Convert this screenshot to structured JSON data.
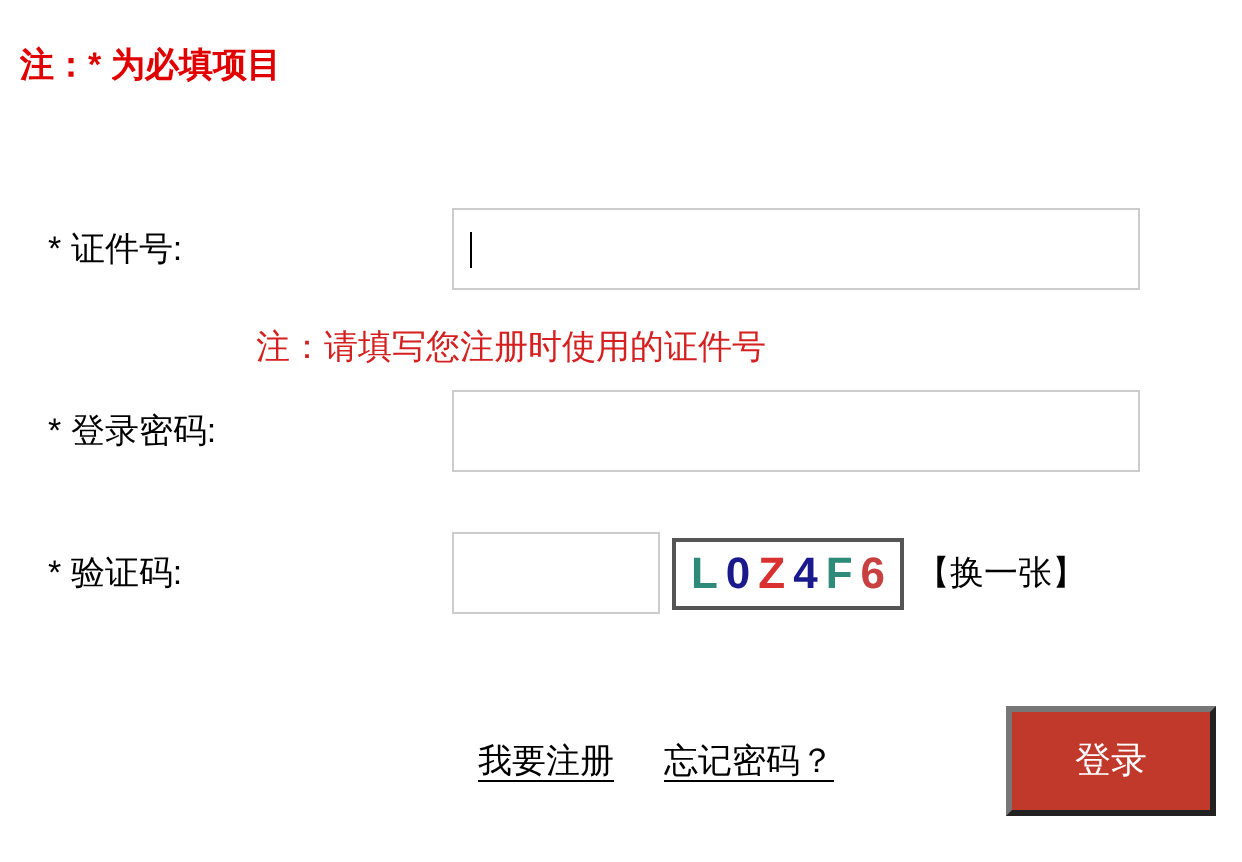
{
  "required_note": "注：* 为必填项目",
  "fields": [
    {
      "label": "* 证件号:",
      "kind": "text",
      "focused": true,
      "hint": "注：请填写您注册时使用的证件号"
    },
    {
      "label": "* 登录密码:",
      "kind": "password",
      "focused": false
    },
    {
      "label": "* 验证码:",
      "kind": "captcha",
      "focused": false,
      "captcha": [
        {
          "char": "L",
          "color": "#2e8b7a"
        },
        {
          "char": "0",
          "color": "#1a1a8c"
        },
        {
          "char": "Z",
          "color": "#d93030"
        },
        {
          "char": "4",
          "color": "#1a1a8c"
        },
        {
          "char": "F",
          "color": "#2e8b7a"
        },
        {
          "char": "6",
          "color": "#c84040"
        }
      ],
      "refresh": "【换一张】"
    }
  ],
  "links": [
    "我要注册",
    "忘记密码？"
  ],
  "submit": "登录"
}
